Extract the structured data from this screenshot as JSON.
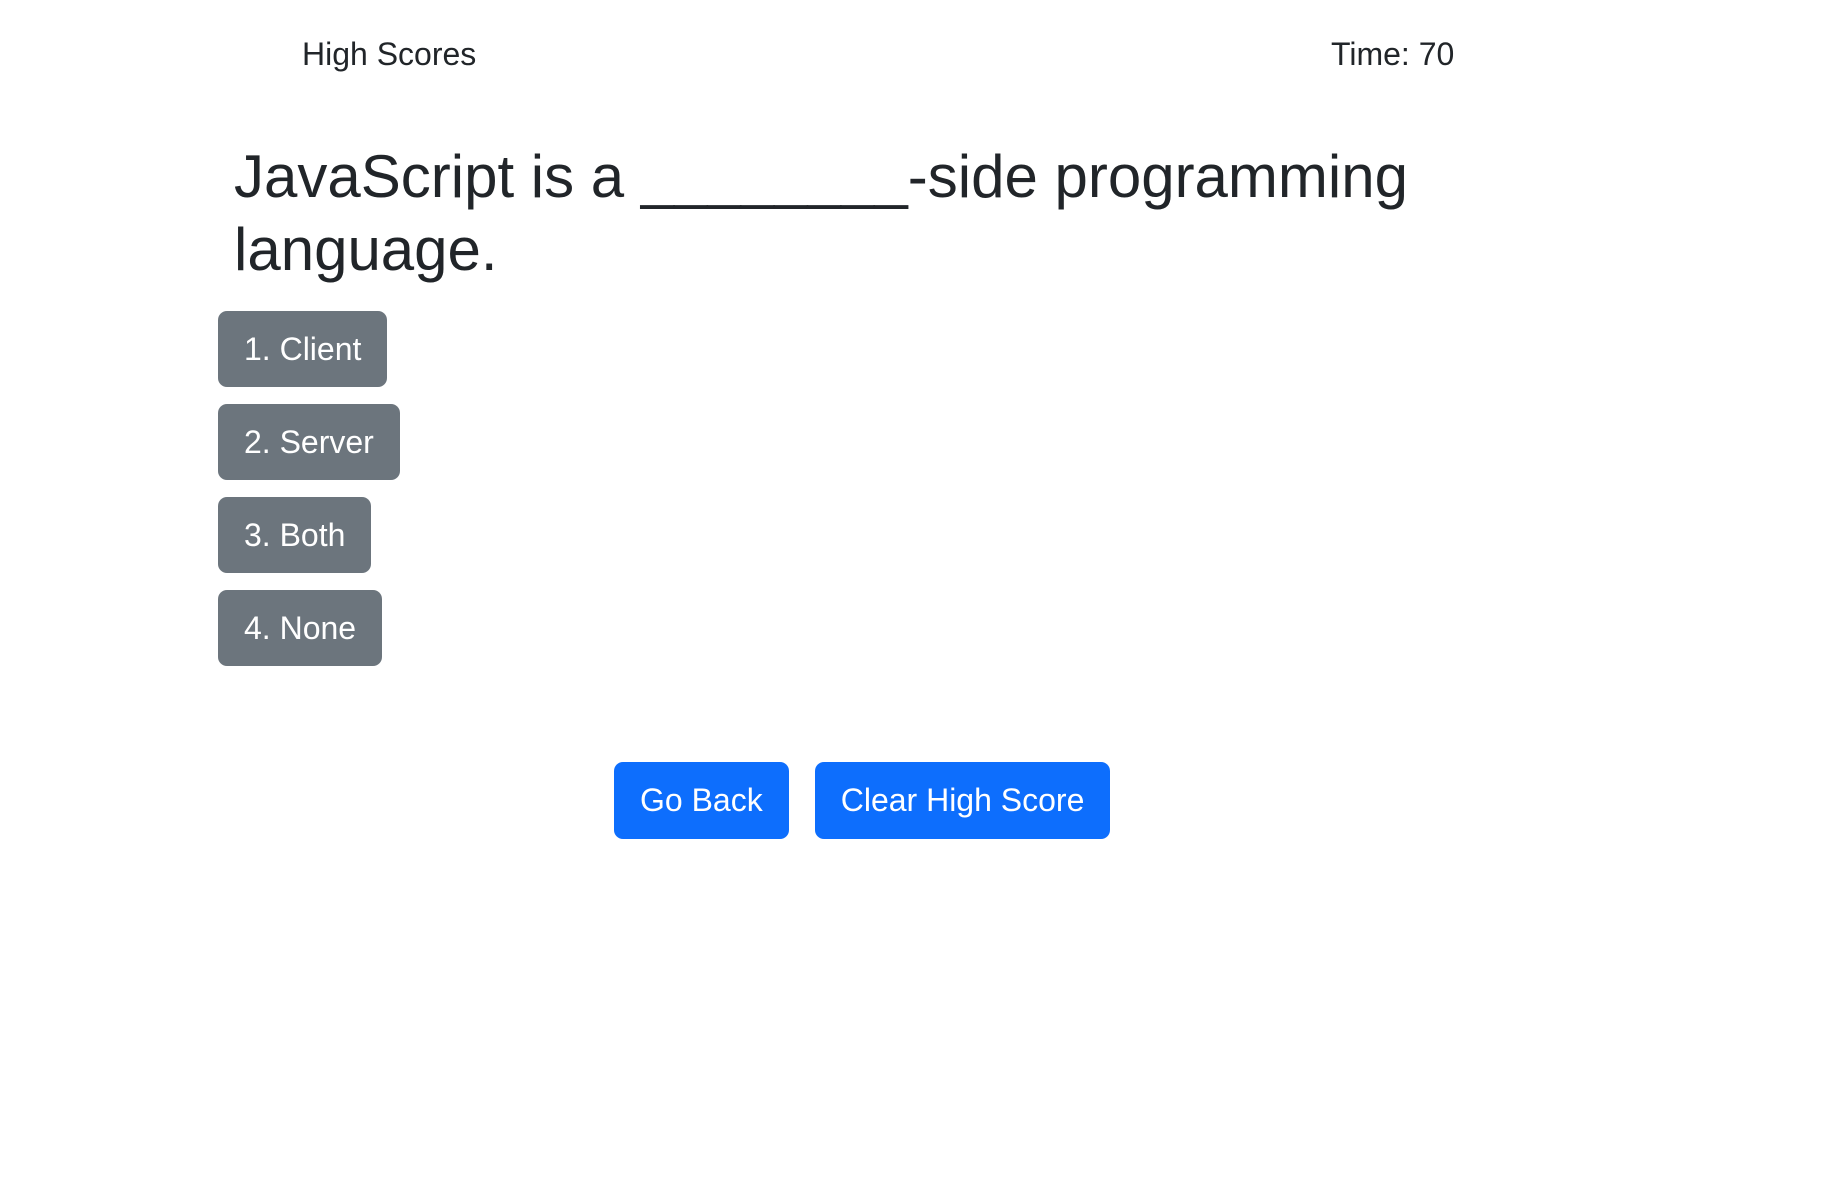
{
  "header": {
    "high_scores_label": "High Scores",
    "timer_label": "Time:",
    "timer_value": "70"
  },
  "quiz": {
    "question": "JavaScript is a ________-side programming language.",
    "choices": [
      {
        "label": "1. Client"
      },
      {
        "label": "2. Server"
      },
      {
        "label": "3. Both"
      },
      {
        "label": "4. None"
      }
    ]
  },
  "actions": {
    "go_back_label": "Go Back",
    "clear_high_score_label": "Clear High Score"
  },
  "colors": {
    "choice_button_bg": "#6c757d",
    "primary_button_bg": "#0d6efd",
    "text": "#212529",
    "background": "#ffffff"
  }
}
